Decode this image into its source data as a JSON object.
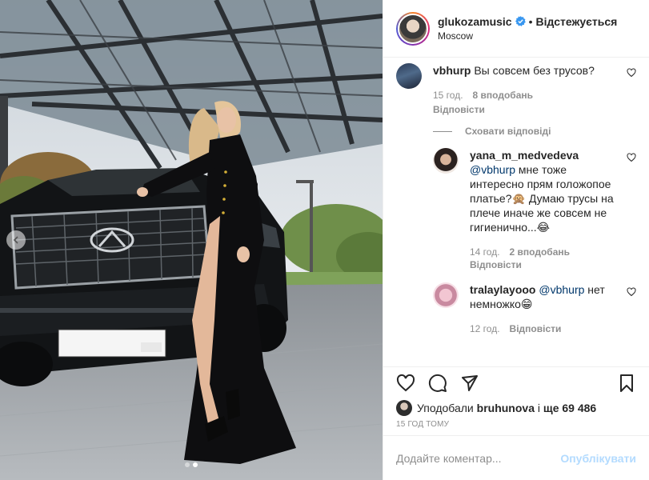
{
  "header": {
    "username": "glukozamusic",
    "follow_state": "Відстежується",
    "location": "Moscow"
  },
  "comments": [
    {
      "user": "vbhurp",
      "text": "Вы совсем без трусов?",
      "time": "15 год.",
      "likes": "8 вподобань",
      "reply": "Відповісти",
      "toggle_replies": "Сховати відповіді",
      "replies": [
        {
          "user": "yana_m_medvedeva",
          "mention": "@vbhurp",
          "text": "мне тоже интересно прям голожопое платье?🙊 Думаю трусы на плече иначе же совсем не гигиенично...😂",
          "time": "14 год.",
          "likes": "2 вподобань",
          "reply": "Відповісти"
        },
        {
          "user": "tralaylayooo",
          "mention": "@vbhurp",
          "text": "нет немножко😁",
          "time": "12 год.",
          "reply": "Відповісти"
        }
      ]
    }
  ],
  "likes": {
    "prefix": "Уподобали",
    "user": "bruhunova",
    "connector": "і",
    "others": "ще 69 486"
  },
  "timestamp": "15 ГОД ТОМУ",
  "add_comment": {
    "placeholder": "Додайте коментар...",
    "publish_label": "Опублікувати"
  },
  "carousel": {
    "total": 2,
    "active_index": 1
  },
  "colors": {
    "link_blue": "#00376b",
    "verified_blue": "#3897f0",
    "publish_disabled": "#b3dbff",
    "meta_gray": "#8e8e8e"
  }
}
